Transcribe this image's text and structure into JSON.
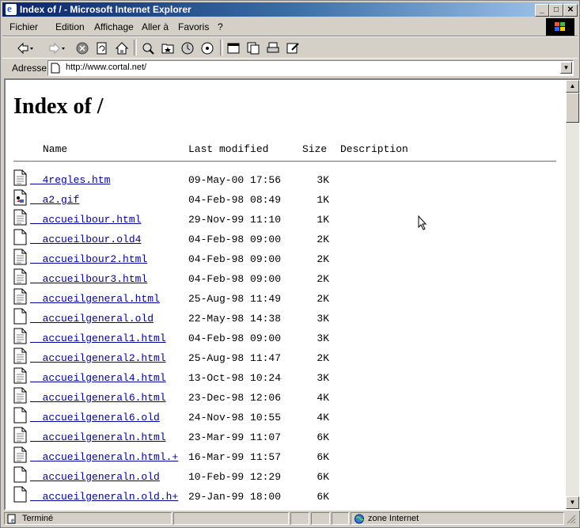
{
  "window": {
    "title": "Index of / - Microsoft Internet Explorer"
  },
  "menu": [
    "Fichier",
    "Edition",
    "Affichage",
    "Aller à",
    "Favoris",
    "?"
  ],
  "address": {
    "label": "Adresse",
    "url": "http://www.cortal.net/"
  },
  "page": {
    "heading": "Index of /",
    "columns": {
      "name": "Name",
      "modified": "Last modified",
      "size": "Size",
      "description": "Description"
    },
    "files": [
      {
        "name": "4regles.htm",
        "modified": "09-May-00 17:56",
        "size": "3K",
        "icon": "text-file-icon"
      },
      {
        "name": "a2.gif",
        "modified": "04-Feb-98 08:49",
        "size": "1K",
        "icon": "image-file-icon"
      },
      {
        "name": "accueilbour.html",
        "modified": "29-Nov-99 11:10",
        "size": "1K",
        "icon": "text-file-icon"
      },
      {
        "name": "accueilbour.old4",
        "modified": "04-Feb-98 09:00",
        "size": "2K",
        "icon": "blank-file-icon"
      },
      {
        "name": "accueilbour2.html",
        "modified": "04-Feb-98 09:00",
        "size": "2K",
        "icon": "text-file-icon"
      },
      {
        "name": "accueilbour3.html",
        "modified": "04-Feb-98 09:00",
        "size": "2K",
        "icon": "text-file-icon"
      },
      {
        "name": "accueilgeneral.html",
        "modified": "25-Aug-98 11:49",
        "size": "2K",
        "icon": "text-file-icon"
      },
      {
        "name": "accueilgeneral.old",
        "modified": "22-May-98 14:38",
        "size": "3K",
        "icon": "blank-file-icon"
      },
      {
        "name": "accueilgeneral1.html",
        "modified": "04-Feb-98 09:00",
        "size": "3K",
        "icon": "text-file-icon"
      },
      {
        "name": "accueilgeneral2.html",
        "modified": "25-Aug-98 11:47",
        "size": "2K",
        "icon": "text-file-icon"
      },
      {
        "name": "accueilgeneral4.html",
        "modified": "13-Oct-98 10:24",
        "size": "3K",
        "icon": "text-file-icon"
      },
      {
        "name": "accueilgeneral6.html",
        "modified": "23-Dec-98 12:06",
        "size": "4K",
        "icon": "text-file-icon"
      },
      {
        "name": "accueilgeneral6.old",
        "modified": "24-Nov-98 10:55",
        "size": "4K",
        "icon": "blank-file-icon"
      },
      {
        "name": "accueilgeneraln.html",
        "modified": "23-Mar-99 11:07",
        "size": "6K",
        "icon": "text-file-icon"
      },
      {
        "name": "accueilgeneraln.html.+",
        "modified": "16-Mar-99 11:57",
        "size": "6K",
        "icon": "text-file-icon"
      },
      {
        "name": "accueilgeneraln.old",
        "modified": "10-Feb-99 12:29",
        "size": "6K",
        "icon": "blank-file-icon"
      },
      {
        "name": "accueilgeneraln.old.h+",
        "modified": "29-Jan-99 18:00",
        "size": "6K",
        "icon": "blank-file-icon"
      }
    ]
  },
  "status": {
    "left": "Terminé",
    "zone": "zone Internet"
  },
  "colors": {
    "title_start": "#0a246a",
    "title_end": "#a6caf0",
    "link": "#0000a0",
    "chrome": "#d4d0c8"
  }
}
